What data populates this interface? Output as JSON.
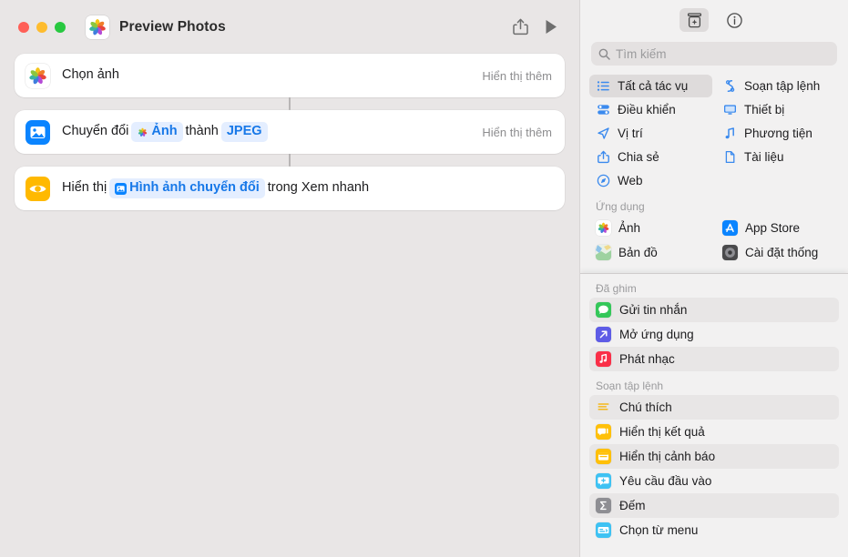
{
  "window": {
    "title": "Preview Photos",
    "doc_icon": "photos-app-icon",
    "traffic_lights": [
      "close",
      "minimize",
      "zoom"
    ],
    "toolbar": [
      {
        "name": "share-button",
        "icon": "share-icon"
      },
      {
        "name": "run-button",
        "icon": "play-icon"
      }
    ]
  },
  "workflow": {
    "actions": [
      {
        "icon": "photos-app-icon",
        "icon_style": "photos",
        "show_more": "Hiển thị thêm",
        "parts": [
          {
            "type": "text",
            "text": "Chọn ảnh"
          }
        ]
      },
      {
        "icon": "image-icon",
        "icon_style": "blue",
        "show_more": "Hiển thị thêm",
        "parts": [
          {
            "type": "text",
            "text": "Chuyển đổi"
          },
          {
            "type": "pill",
            "text": "Ảnh",
            "icon": "photos-pinwheel-icon"
          },
          {
            "type": "text",
            "text": "thành"
          },
          {
            "type": "pill",
            "text": "JPEG"
          }
        ]
      },
      {
        "icon": "eye-icon",
        "icon_style": "yellow",
        "show_more": "",
        "parts": [
          {
            "type": "text",
            "text": "Hiển thị"
          },
          {
            "type": "pill",
            "text": "Hình ảnh chuyển đổi",
            "icon": "image-variable-icon"
          },
          {
            "type": "text",
            "text": "trong Xem nhanh"
          }
        ]
      }
    ]
  },
  "sidebar": {
    "toolbar": [
      {
        "name": "action-library-button",
        "icon": "add-action-icon",
        "active": true
      },
      {
        "name": "info-button",
        "icon": "info-circle-icon",
        "active": false
      }
    ],
    "search": {
      "placeholder": "Tìm kiếm",
      "value": "",
      "icon": "search-icon"
    },
    "categories": [
      {
        "label": "Tất cả tác vụ",
        "icon": "list-bullet-icon",
        "selected": true
      },
      {
        "label": "Soạn tập lệnh",
        "icon": "scripting-swirl-icon",
        "selected": false
      },
      {
        "label": "Điều khiển",
        "icon": "sliders-icon",
        "selected": false
      },
      {
        "label": "Thiết bị",
        "icon": "display-icon",
        "selected": false
      },
      {
        "label": "Vị trí",
        "icon": "location-arrow-icon",
        "selected": false
      },
      {
        "label": "Phương tiện",
        "icon": "music-note-icon",
        "selected": false
      },
      {
        "label": "Chia sẻ",
        "icon": "share-icon",
        "selected": false
      },
      {
        "label": "Tài liệu",
        "icon": "document-icon",
        "selected": false
      },
      {
        "label": "Web",
        "icon": "compass-icon",
        "selected": false
      }
    ],
    "apps_section": {
      "header": "Ứng dụng",
      "items": [
        {
          "label": "Ảnh",
          "icon": "photos-app-icon"
        },
        {
          "label": "App Store",
          "icon": "app-store-icon"
        },
        {
          "label": "Bản đồ",
          "icon": "maps-app-icon"
        },
        {
          "label": "Cài đặt  thống",
          "icon": "system-settings-icon"
        }
      ]
    },
    "pinned_section": {
      "header": "Đã ghim",
      "items": [
        {
          "label": "Gửi tin nhắn",
          "icon": "messages-icon",
          "alt": true
        },
        {
          "label": "Mở ứng dụng",
          "icon": "open-app-icon",
          "alt": false
        },
        {
          "label": "Phát nhạc",
          "icon": "music-icon",
          "alt": true
        }
      ]
    },
    "scripting_section": {
      "header": "Soạn tập lệnh",
      "items": [
        {
          "label": "Chú thích",
          "icon": "comment-icon",
          "alt": true
        },
        {
          "label": "Hiển thị kết quả",
          "icon": "show-result-icon",
          "alt": false
        },
        {
          "label": "Hiển thị cảnh báo",
          "icon": "show-alert-icon",
          "alt": true
        },
        {
          "label": "Yêu cầu đầu vào",
          "icon": "ask-input-icon",
          "alt": false
        },
        {
          "label": "Đếm",
          "icon": "count-sigma-icon",
          "alt": true
        },
        {
          "label": "Chọn từ menu",
          "icon": "choose-menu-icon",
          "alt": false
        }
      ]
    }
  },
  "colors": {
    "accent_blue": "#0a84ff",
    "pill_bg": "#e4eeff",
    "pill_text": "#1778e8",
    "canvas_bg": "#e9e6e6",
    "sidebar_bg": "#f2f1f1",
    "yellow": "#ffb900"
  }
}
